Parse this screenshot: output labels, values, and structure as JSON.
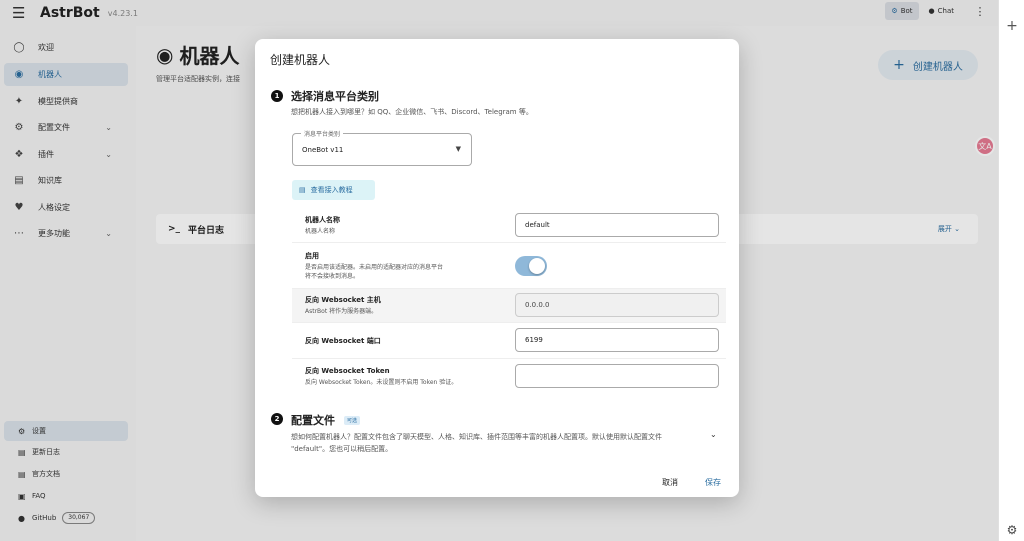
{
  "app": {
    "brand": "AstrBot",
    "version": "v4.23.1",
    "mode_bot": "Bot",
    "mode_chat": "Chat"
  },
  "sidebar": {
    "items": [
      {
        "label": "欢迎",
        "icon": "welcome-icon"
      },
      {
        "label": "机器人",
        "icon": "robot-icon"
      },
      {
        "label": "模型提供商",
        "icon": "sparkle-icon"
      },
      {
        "label": "配置文件",
        "icon": "gear-icon"
      },
      {
        "label": "插件",
        "icon": "puzzle-icon"
      },
      {
        "label": "知识库",
        "icon": "book-icon"
      },
      {
        "label": "人格设定",
        "icon": "heart-icon"
      },
      {
        "label": "更多功能",
        "icon": "more-icon"
      }
    ],
    "bottom": [
      {
        "label": "设置"
      },
      {
        "label": "更新日志"
      },
      {
        "label": "官方文档"
      },
      {
        "label": "FAQ"
      },
      {
        "label": "GitHub",
        "count": "30,067"
      }
    ]
  },
  "main": {
    "title": "机器人",
    "subtitle": "管理平台适配器实例，连接",
    "create_button": "创建机器人",
    "log_title": "平台日志",
    "log_expand": "展开"
  },
  "modal": {
    "title": "创建机器人",
    "step1": {
      "num": "1",
      "title": "选择消息平台类别",
      "desc": "想把机器人接入到哪里？如 QQ、企业微信、飞书、Discord、Telegram 等。",
      "select_label": "消息平台类别",
      "select_value": "OneBot v11",
      "tutorial": "查看接入教程"
    },
    "fields": {
      "name": {
        "label": "机器人名称",
        "hint": "机器人名称",
        "value": "default"
      },
      "enable": {
        "label": "启用",
        "hint": "是否启用该适配器。未启用的适配器对应的消息平台将不会接收到消息。",
        "on": true
      },
      "ws_host": {
        "label": "反向 Websocket 主机",
        "hint": "AstrBot 将作为服务器端。",
        "value": "0.0.0.0"
      },
      "ws_port": {
        "label": "反向 Websocket 端口",
        "value": "6199"
      },
      "ws_token": {
        "label": "反向 Websocket Token",
        "hint": "反向 Websocket Token。未设置则不启用 Token 验证。",
        "value": ""
      }
    },
    "step2": {
      "num": "2",
      "title": "配置文件",
      "tag": "可选",
      "desc": "想如何配置机器人？配置文件包含了聊天模型、人格、知识库、插件范围等丰富的机器人配置项。默认使用默认配置文件 \"default\"。您也可以稍后配置。"
    },
    "cancel": "取消",
    "save": "保存"
  },
  "colors": {
    "accent": "#2a6da0",
    "toggle": "#8fb8d9",
    "tag_bg": "#dcecf7",
    "tutorial_bg": "#dcf3f7"
  }
}
